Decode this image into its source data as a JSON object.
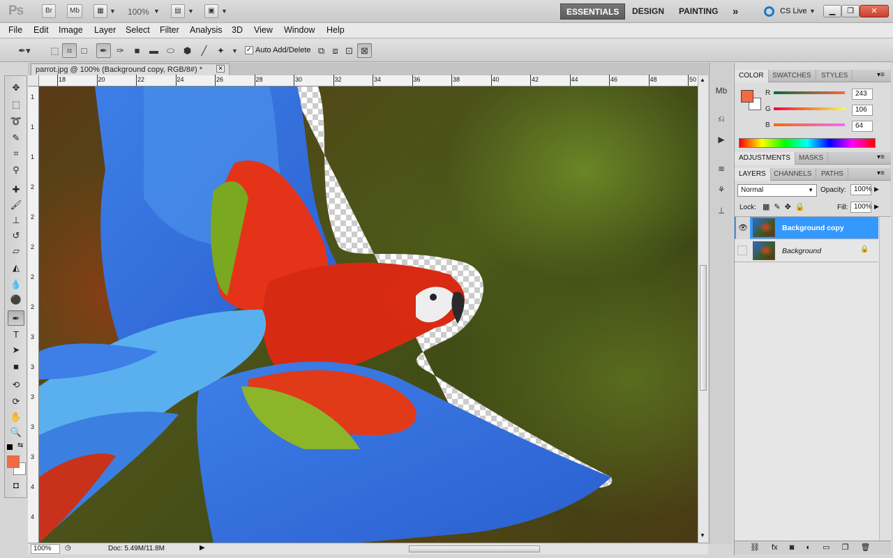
{
  "appbar": {
    "logo": "Ps",
    "br": "Br",
    "mb": "Mb",
    "zoom": "100%",
    "workspaces": [
      "ESSENTIALS",
      "DESIGN",
      "PAINTING"
    ],
    "more": "»",
    "cslive": "CS Live"
  },
  "menu": [
    "File",
    "Edit",
    "Image",
    "Layer",
    "Select",
    "Filter",
    "Analysis",
    "3D",
    "View",
    "Window",
    "Help"
  ],
  "options": {
    "auto_add_delete": "Auto Add/Delete"
  },
  "doc": {
    "tab_title": "parrot.jpg @ 100% (Background copy, RGB/8#) *",
    "close": "✕"
  },
  "rulers": {
    "h": [
      "18",
      "20",
      "22",
      "24",
      "26",
      "28",
      "30",
      "32",
      "34",
      "36",
      "38",
      "40",
      "42",
      "44",
      "46",
      "48",
      "50"
    ],
    "v": [
      "1",
      "1",
      "1",
      "2",
      "2",
      "2",
      "2",
      "2",
      "3",
      "3",
      "3",
      "3",
      "3",
      "4",
      "4"
    ]
  },
  "status": {
    "zoom": "100%",
    "doc": "Doc: 5.49M/11.8M"
  },
  "color_panel": {
    "tabs": [
      "COLOR",
      "SWATCHES",
      "STYLES"
    ],
    "r_label": "R",
    "g_label": "G",
    "b_label": "B",
    "r": "243",
    "g": "106",
    "b": "64",
    "fg": "#f36a40"
  },
  "adjust_panel": {
    "tabs": [
      "ADJUSTMENTS",
      "MASKS"
    ]
  },
  "layers_panel": {
    "tabs": [
      "LAYERS",
      "CHANNELS",
      "PATHS"
    ],
    "blend": "Normal",
    "opacity_label": "Opacity:",
    "opacity": "100%",
    "lock_label": "Lock:",
    "fill_label": "Fill:",
    "fill": "100%",
    "layers": [
      {
        "name": "Background copy",
        "selected": true
      },
      {
        "name": "Background",
        "selected": false
      }
    ]
  },
  "colors": {
    "selection": "#3399ff",
    "fg": "#f36a40"
  }
}
